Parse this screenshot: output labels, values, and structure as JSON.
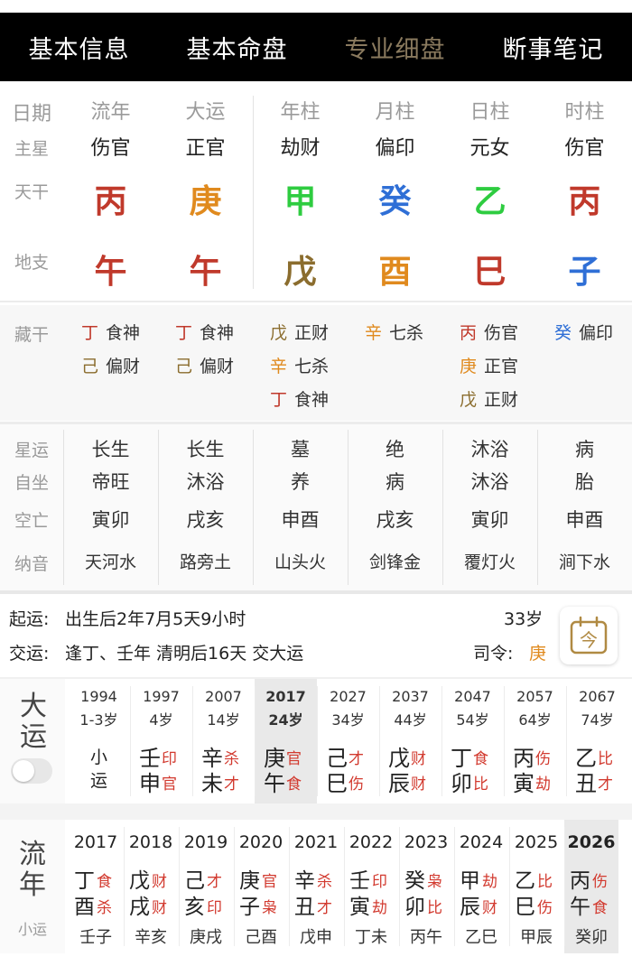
{
  "tabs": [
    "基本信息",
    "基本命盘",
    "专业细盘",
    "断事笔记"
  ],
  "active_tab": 2,
  "pillars": {
    "row_labels": {
      "date": "日期",
      "star": "主星",
      "stem": "天干",
      "branch": "地支"
    },
    "columns": [
      {
        "header": "流年",
        "star": "伤官",
        "stem": "丙",
        "stem_color": "#c0392b",
        "branch": "午",
        "branch_color": "#c0392b"
      },
      {
        "header": "大运",
        "star": "正官",
        "stem": "庚",
        "stem_color": "#e08a1e",
        "branch": "午",
        "branch_color": "#c0392b"
      },
      {
        "header": "年柱",
        "star": "劫财",
        "stem": "甲",
        "stem_color": "#2ecc40",
        "branch": "戊",
        "branch_color": "#8b6d2e"
      },
      {
        "header": "月柱",
        "star": "偏印",
        "stem": "癸",
        "stem_color": "#2f6fd6",
        "branch": "酉",
        "branch_color": "#e08a1e"
      },
      {
        "header": "日柱",
        "star": "元女",
        "stem": "乙",
        "stem_color": "#2ecc40",
        "branch": "巳",
        "branch_color": "#c0392b"
      },
      {
        "header": "时柱",
        "star": "伤官",
        "stem": "丙",
        "stem_color": "#c0392b",
        "branch": "子",
        "branch_color": "#2f6fd6"
      }
    ]
  },
  "canggan": {
    "label": "藏干",
    "columns": [
      [
        {
          "s": "丁",
          "c": "#c0392b",
          "g": "食神"
        },
        {
          "s": "己",
          "c": "#8b6d2e",
          "g": "偏财"
        }
      ],
      [
        {
          "s": "丁",
          "c": "#c0392b",
          "g": "食神"
        },
        {
          "s": "己",
          "c": "#8b6d2e",
          "g": "偏财"
        }
      ],
      [
        {
          "s": "戊",
          "c": "#8b6d2e",
          "g": "正财"
        },
        {
          "s": "辛",
          "c": "#e08a1e",
          "g": "七杀"
        },
        {
          "s": "丁",
          "c": "#c0392b",
          "g": "食神"
        }
      ],
      [
        {
          "s": "辛",
          "c": "#e08a1e",
          "g": "七杀"
        }
      ],
      [
        {
          "s": "丙",
          "c": "#c0392b",
          "g": "伤官"
        },
        {
          "s": "庚",
          "c": "#e08a1e",
          "g": "正官"
        },
        {
          "s": "戊",
          "c": "#8b6d2e",
          "g": "正财"
        }
      ],
      [
        {
          "s": "癸",
          "c": "#2f6fd6",
          "g": "偏印"
        }
      ]
    ]
  },
  "fortune": {
    "labels": [
      "星运",
      "自坐",
      "空亡",
      "纳音"
    ],
    "rows": [
      [
        "长生",
        "长生",
        "墓",
        "绝",
        "沐浴",
        "病"
      ],
      [
        "帝旺",
        "沐浴",
        "养",
        "病",
        "沐浴",
        "胎"
      ],
      [
        "寅卯",
        "戌亥",
        "申酉",
        "戌亥",
        "寅卯",
        "申酉"
      ],
      [
        "天河水",
        "路旁土",
        "山头火",
        "剑锋金",
        "覆灯火",
        "涧下水"
      ]
    ]
  },
  "info": {
    "qiyun_label": "起运:",
    "qiyun_value": "出生后2年7月5天9小时",
    "age": "33岁",
    "jiaoyun_label": "交运:",
    "jiaoyun_value": "逢丁、壬年 清明后16天 交大运",
    "siling_label": "司令:",
    "siling_value": "庚",
    "calendar_char": "今"
  },
  "dayun": {
    "title": "大运",
    "columns": [
      {
        "year": "1994",
        "age": "1-3岁",
        "xiaoyun": [
          "小",
          "运"
        ]
      },
      {
        "year": "1997",
        "age": "4岁",
        "g1": "壬",
        "t1": "印",
        "g2": "申",
        "t2": "官"
      },
      {
        "year": "2007",
        "age": "14岁",
        "g1": "辛",
        "t1": "杀",
        "g2": "未",
        "t2": "才"
      },
      {
        "year": "2017",
        "age": "24岁",
        "g1": "庚",
        "t1": "官",
        "g2": "午",
        "t2": "食",
        "selected": true
      },
      {
        "year": "2027",
        "age": "34岁",
        "g1": "己",
        "t1": "才",
        "g2": "巳",
        "t2": "伤"
      },
      {
        "year": "2037",
        "age": "44岁",
        "g1": "戊",
        "t1": "财",
        "g2": "辰",
        "t2": "财"
      },
      {
        "year": "2047",
        "age": "54岁",
        "g1": "丁",
        "t1": "食",
        "g2": "卯",
        "t2": "比"
      },
      {
        "year": "2057",
        "age": "64岁",
        "g1": "丙",
        "t1": "伤",
        "g2": "寅",
        "t2": "劫"
      },
      {
        "year": "2067",
        "age": "74岁",
        "g1": "乙",
        "t1": "比",
        "g2": "丑",
        "t2": "才"
      }
    ]
  },
  "liunian": {
    "title": "流年",
    "xiaoyun_label": "小运",
    "columns": [
      {
        "year": "2017",
        "g1": "丁",
        "t1": "食",
        "g2": "酉",
        "t2": "杀",
        "xy": "壬子"
      },
      {
        "year": "2018",
        "g1": "戊",
        "t1": "财",
        "g2": "戌",
        "t2": "财",
        "xy": "辛亥"
      },
      {
        "year": "2019",
        "g1": "己",
        "t1": "才",
        "g2": "亥",
        "t2": "印",
        "xy": "庚戌"
      },
      {
        "year": "2020",
        "g1": "庚",
        "t1": "官",
        "g2": "子",
        "t2": "枭",
        "xy": "己酉"
      },
      {
        "year": "2021",
        "g1": "辛",
        "t1": "杀",
        "g2": "丑",
        "t2": "才",
        "xy": "戊申"
      },
      {
        "year": "2022",
        "g1": "壬",
        "t1": "印",
        "g2": "寅",
        "t2": "劫",
        "xy": "丁未"
      },
      {
        "year": "2023",
        "g1": "癸",
        "t1": "枭",
        "g2": "卯",
        "t2": "比",
        "xy": "丙午"
      },
      {
        "year": "2024",
        "g1": "甲",
        "t1": "劫",
        "g2": "辰",
        "t2": "财",
        "xy": "乙巳"
      },
      {
        "year": "2025",
        "g1": "乙",
        "t1": "比",
        "g2": "巳",
        "t2": "伤",
        "xy": "甲辰"
      },
      {
        "year": "2026",
        "g1": "丙",
        "t1": "伤",
        "g2": "午",
        "t2": "食",
        "xy": "癸卯",
        "selected": true
      }
    ]
  },
  "colors": {
    "tag_red": "#d23a2f",
    "active_tab": "#8a7a5e",
    "siling": "#e08a1e"
  }
}
